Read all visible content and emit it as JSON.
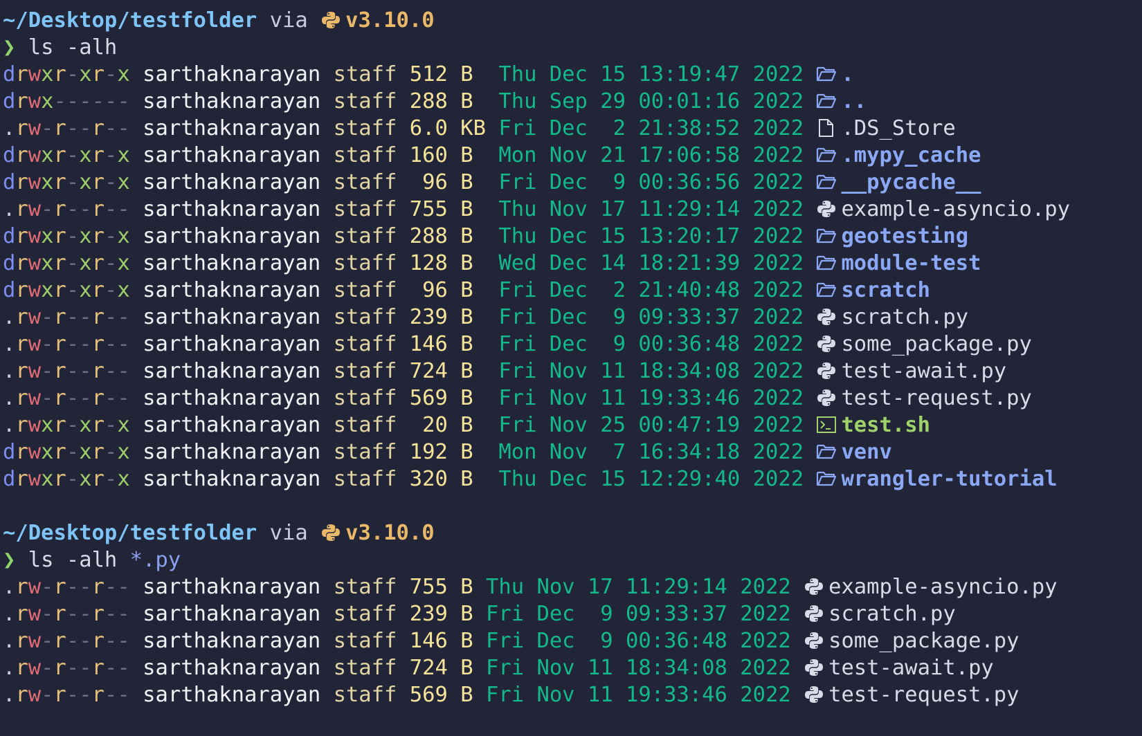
{
  "colors": {
    "background": "#222537",
    "path": "#7ec4f6",
    "version": "#e9b969",
    "prompt": "#8fd46c",
    "date": "#13b98a",
    "directory": "#8aa8f5",
    "size": "#f5e39a"
  },
  "prompts": [
    {
      "path": "~/Desktop/testfolder",
      "via": "via",
      "python_icon": "python-icon",
      "version": "v3.10.0",
      "prompt_symbol": "❯",
      "command": "ls -alh",
      "glob": ""
    },
    {
      "path": "~/Desktop/testfolder",
      "via": "via",
      "python_icon": "python-icon",
      "version": "v3.10.0",
      "prompt_symbol": "❯",
      "command": "ls -alh ",
      "glob": "*.py"
    }
  ],
  "listing1": [
    {
      "perms": "drwxr-xr-x",
      "user": "sarthaknarayan",
      "group": "staff",
      "size": "512",
      "unit": "B ",
      "date": "Thu Dec 15 13:19:47 2022",
      "icon": "folder-icon",
      "name": ".",
      "kind": "dir"
    },
    {
      "perms": "drwx------",
      "user": "sarthaknarayan",
      "group": "staff",
      "size": "288",
      "unit": "B ",
      "date": "Thu Sep 29 00:01:16 2022",
      "icon": "folder-icon",
      "name": "..",
      "kind": "dir"
    },
    {
      "perms": ".rw-r--r--",
      "user": "sarthaknarayan",
      "group": "staff",
      "size": "6.0",
      "unit": "KB",
      "date": "Fri Dec  2 21:38:52 2022",
      "icon": "file-icon",
      "name": ".DS_Store",
      "kind": "file"
    },
    {
      "perms": "drwxr-xr-x",
      "user": "sarthaknarayan",
      "group": "staff",
      "size": "160",
      "unit": "B ",
      "date": "Mon Nov 21 17:06:58 2022",
      "icon": "folder-icon",
      "name": ".mypy_cache",
      "kind": "dir"
    },
    {
      "perms": "drwxr-xr-x",
      "user": "sarthaknarayan",
      "group": "staff",
      "size": " 96",
      "unit": "B ",
      "date": "Fri Dec  9 00:36:56 2022",
      "icon": "folder-icon",
      "name": "__pycache__",
      "kind": "dir"
    },
    {
      "perms": ".rw-r--r--",
      "user": "sarthaknarayan",
      "group": "staff",
      "size": "755",
      "unit": "B ",
      "date": "Thu Nov 17 11:29:14 2022",
      "icon": "python-icon",
      "name": "example-asyncio.py",
      "kind": "file"
    },
    {
      "perms": "drwxr-xr-x",
      "user": "sarthaknarayan",
      "group": "staff",
      "size": "288",
      "unit": "B ",
      "date": "Thu Dec 15 13:20:17 2022",
      "icon": "folder-icon",
      "name": "geotesting",
      "kind": "dir"
    },
    {
      "perms": "drwxr-xr-x",
      "user": "sarthaknarayan",
      "group": "staff",
      "size": "128",
      "unit": "B ",
      "date": "Wed Dec 14 18:21:39 2022",
      "icon": "folder-icon",
      "name": "module-test",
      "kind": "dir"
    },
    {
      "perms": "drwxr-xr-x",
      "user": "sarthaknarayan",
      "group": "staff",
      "size": " 96",
      "unit": "B ",
      "date": "Fri Dec  2 21:40:48 2022",
      "icon": "folder-icon",
      "name": "scratch",
      "kind": "dir"
    },
    {
      "perms": ".rw-r--r--",
      "user": "sarthaknarayan",
      "group": "staff",
      "size": "239",
      "unit": "B ",
      "date": "Fri Dec  9 09:33:37 2022",
      "icon": "python-icon",
      "name": "scratch.py",
      "kind": "file"
    },
    {
      "perms": ".rw-r--r--",
      "user": "sarthaknarayan",
      "group": "staff",
      "size": "146",
      "unit": "B ",
      "date": "Fri Dec  9 00:36:48 2022",
      "icon": "python-icon",
      "name": "some_package.py",
      "kind": "file"
    },
    {
      "perms": ".rw-r--r--",
      "user": "sarthaknarayan",
      "group": "staff",
      "size": "724",
      "unit": "B ",
      "date": "Fri Nov 11 18:34:08 2022",
      "icon": "python-icon",
      "name": "test-await.py",
      "kind": "file"
    },
    {
      "perms": ".rw-r--r--",
      "user": "sarthaknarayan",
      "group": "staff",
      "size": "569",
      "unit": "B ",
      "date": "Fri Nov 11 19:33:46 2022",
      "icon": "python-icon",
      "name": "test-request.py",
      "kind": "file"
    },
    {
      "perms": ".rwxr-xr-x",
      "user": "sarthaknarayan",
      "group": "staff",
      "size": " 20",
      "unit": "B ",
      "date": "Fri Nov 25 00:47:19 2022",
      "icon": "terminal-icon",
      "name": "test.sh",
      "kind": "exec"
    },
    {
      "perms": "drwxr-xr-x",
      "user": "sarthaknarayan",
      "group": "staff",
      "size": "192",
      "unit": "B ",
      "date": "Mon Nov  7 16:34:18 2022",
      "icon": "folder-icon",
      "name": "venv",
      "kind": "dir"
    },
    {
      "perms": "drwxr-xr-x",
      "user": "sarthaknarayan",
      "group": "staff",
      "size": "320",
      "unit": "B ",
      "date": "Thu Dec 15 12:29:40 2022",
      "icon": "folder-icon",
      "name": "wrangler-tutorial",
      "kind": "dir"
    }
  ],
  "listing2": [
    {
      "perms": ".rw-r--r--",
      "user": "sarthaknarayan",
      "group": "staff",
      "size": "755",
      "unit": "B",
      "date": "Thu Nov 17 11:29:14 2022",
      "icon": "python-icon",
      "name": "example-asyncio.py",
      "kind": "file"
    },
    {
      "perms": ".rw-r--r--",
      "user": "sarthaknarayan",
      "group": "staff",
      "size": "239",
      "unit": "B",
      "date": "Fri Dec  9 09:33:37 2022",
      "icon": "python-icon",
      "name": "scratch.py",
      "kind": "file"
    },
    {
      "perms": ".rw-r--r--",
      "user": "sarthaknarayan",
      "group": "staff",
      "size": "146",
      "unit": "B",
      "date": "Fri Dec  9 00:36:48 2022",
      "icon": "python-icon",
      "name": "some_package.py",
      "kind": "file"
    },
    {
      "perms": ".rw-r--r--",
      "user": "sarthaknarayan",
      "group": "staff",
      "size": "724",
      "unit": "B",
      "date": "Fri Nov 11 18:34:08 2022",
      "icon": "python-icon",
      "name": "test-await.py",
      "kind": "file"
    },
    {
      "perms": ".rw-r--r--",
      "user": "sarthaknarayan",
      "group": "staff",
      "size": "569",
      "unit": "B",
      "date": "Fri Nov 11 19:33:46 2022",
      "icon": "python-icon",
      "name": "test-request.py",
      "kind": "file"
    }
  ]
}
